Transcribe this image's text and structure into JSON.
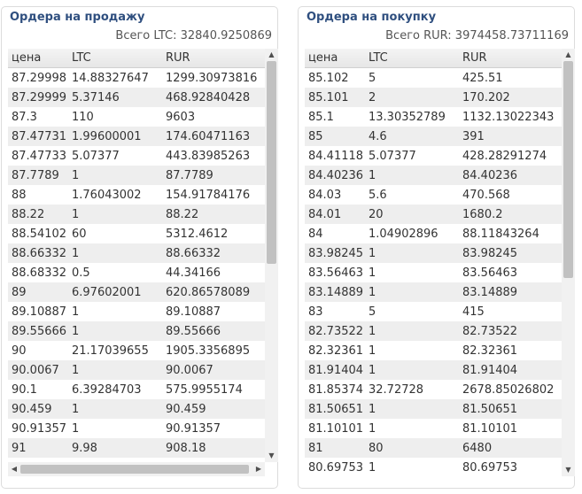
{
  "sell": {
    "title": "Ордера на продажу",
    "total": "Всего LTC: 32840.9250869",
    "columns": [
      "цена",
      "LTC",
      "RUR"
    ],
    "rows": [
      [
        "87.29998",
        "14.88327647",
        "1299.30973816"
      ],
      [
        "87.29999",
        "5.37146",
        "468.92840428"
      ],
      [
        "87.3",
        "110",
        "9603"
      ],
      [
        "87.47731",
        "1.99600001",
        "174.60471163"
      ],
      [
        "87.47733",
        "5.07377",
        "443.83985263"
      ],
      [
        "87.7789",
        "1",
        "87.7789"
      ],
      [
        "88",
        "1.76043002",
        "154.91784176"
      ],
      [
        "88.22",
        "1",
        "88.22"
      ],
      [
        "88.54102",
        "60",
        "5312.4612"
      ],
      [
        "88.66332",
        "1",
        "88.66332"
      ],
      [
        "88.68332",
        "0.5",
        "44.34166"
      ],
      [
        "89",
        "6.97602001",
        "620.86578089"
      ],
      [
        "89.10887",
        "1",
        "89.10887"
      ],
      [
        "89.55666",
        "1",
        "89.55666"
      ],
      [
        "90",
        "21.17039655",
        "1905.3356895"
      ],
      [
        "90.0067",
        "1",
        "90.0067"
      ],
      [
        "90.1",
        "6.39284703",
        "575.9955174"
      ],
      [
        "90.459",
        "1",
        "90.459"
      ],
      [
        "90.91357",
        "1",
        "90.91357"
      ],
      [
        "91",
        "9.98",
        "908.18"
      ]
    ],
    "scroll_position": 0
  },
  "buy": {
    "title": "Ордера на покупку",
    "total": "Всего RUR: 3974458.73711169",
    "columns": [
      "цена",
      "LTC",
      "RUR"
    ],
    "rows": [
      [
        "85.102",
        "5",
        "425.51"
      ],
      [
        "85.101",
        "2",
        "170.202"
      ],
      [
        "85.1",
        "13.30352789",
        "1132.13022343"
      ],
      [
        "85",
        "4.6",
        "391"
      ],
      [
        "84.41118",
        "5.07377",
        "428.28291274"
      ],
      [
        "84.40236",
        "1",
        "84.40236"
      ],
      [
        "84.03",
        "5.6",
        "470.568"
      ],
      [
        "84.01",
        "20",
        "1680.2"
      ],
      [
        "84",
        "1.04902896",
        "88.11843264"
      ],
      [
        "83.98245",
        "1",
        "83.98245"
      ],
      [
        "83.56463",
        "1",
        "83.56463"
      ],
      [
        "83.14889",
        "1",
        "83.14889"
      ],
      [
        "83",
        "5",
        "415"
      ],
      [
        "82.73522",
        "1",
        "82.73522"
      ],
      [
        "82.32361",
        "1",
        "82.32361"
      ],
      [
        "81.91404",
        "1",
        "81.91404"
      ],
      [
        "81.85374",
        "32.72728",
        "2678.85026802"
      ],
      [
        "81.50651",
        "1",
        "81.50651"
      ],
      [
        "81.10101",
        "1",
        "81.10101"
      ],
      [
        "81",
        "80",
        "6480"
      ],
      [
        "80.69753",
        "1",
        "80.69753"
      ]
    ],
    "scroll_position": 0
  }
}
